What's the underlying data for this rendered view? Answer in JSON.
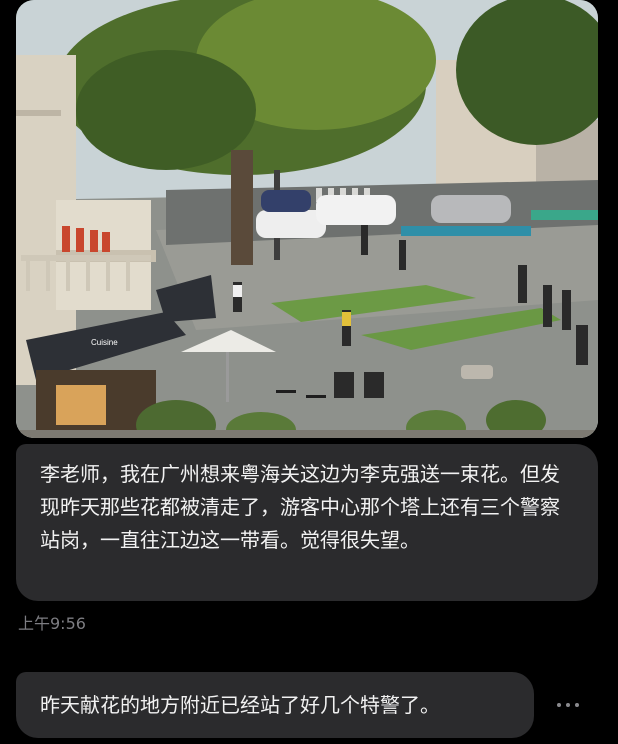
{
  "photo": {
    "alt": "",
    "sign_text": "Cuisine"
  },
  "messages": [
    {
      "text": "李老师，我在广州想来粤海关这边为李克强送一束花。但发现昨天那些花都被清走了，游客中心那个塔上还有三个警察站岗，一直往江边这一带看。觉得很失望。"
    },
    {
      "text": "昨天献花的地方附近已经站了好几个特警了。"
    }
  ],
  "timestamp": "上午9:56",
  "more_icon": "more-horizontal-icon"
}
